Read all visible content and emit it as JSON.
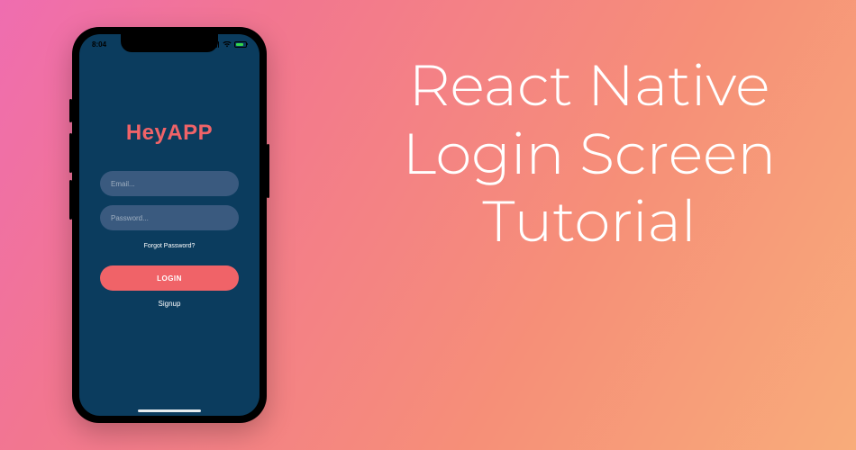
{
  "headline": {
    "line1": "React Native",
    "line2": "Login Screen",
    "line3": "Tutorial"
  },
  "phone": {
    "status": {
      "time": "8:04"
    },
    "app": {
      "logo": "HeyAPP",
      "email_placeholder": "Email...",
      "password_placeholder": "Password...",
      "forgot_label": "Forgot Password?",
      "login_label": "LOGIN",
      "signup_label": "Signup"
    }
  },
  "colors": {
    "phone_body": "#000000",
    "screen_bg": "#0b3c5e",
    "accent": "#f06368",
    "field_bg": "#3a5a7f"
  }
}
